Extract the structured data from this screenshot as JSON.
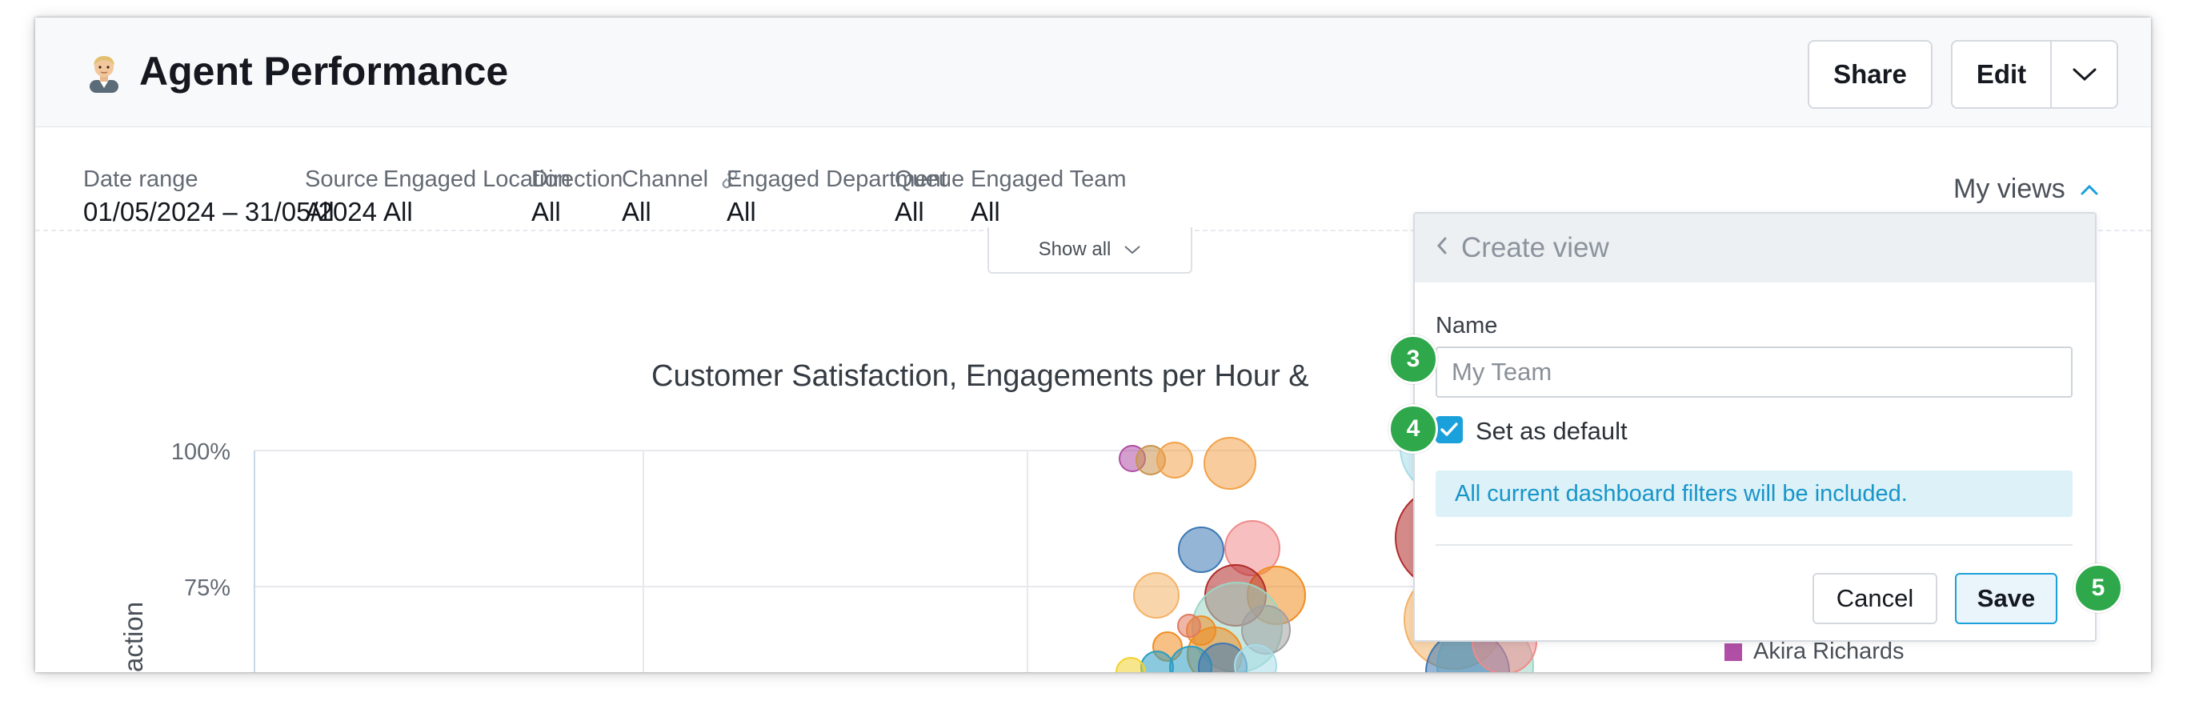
{
  "header": {
    "title": "Agent Performance",
    "share_label": "Share",
    "edit_label": "Edit"
  },
  "filters": [
    {
      "label": "Date range",
      "value": "01/05/2024 – 31/05/2024"
    },
    {
      "label": "Source",
      "value": "All"
    },
    {
      "label": "Engaged Location",
      "value": "All"
    },
    {
      "label": "Direction",
      "value": "All"
    },
    {
      "label": "Channel",
      "value": "All"
    },
    {
      "label": "Engaged Department",
      "value": "All"
    },
    {
      "label": "Queue",
      "value": "All"
    },
    {
      "label": "Engaged Team",
      "value": "All"
    }
  ],
  "my_views_label": "My views",
  "show_all_label": "Show all",
  "chart": {
    "title": "Customer Satisfaction, Engagements per Hour &",
    "ylabel": "action",
    "ytick_labels": [
      "100%",
      "75%"
    ],
    "legend_entry": "Akira Richards"
  },
  "popup": {
    "title": "Create view",
    "name_label": "Name",
    "name_placeholder": "My Team",
    "default_label": "Set as default",
    "default_checked": true,
    "info_text": "All current dashboard filters will be included.",
    "cancel_label": "Cancel",
    "save_label": "Save"
  },
  "badges": [
    "3",
    "4",
    "5"
  ],
  "colors": {
    "accent": "#1aa0da",
    "badge": "#2ea84a",
    "info_bg": "#dcf1f8",
    "legend_akira": "#b04fa5"
  }
}
